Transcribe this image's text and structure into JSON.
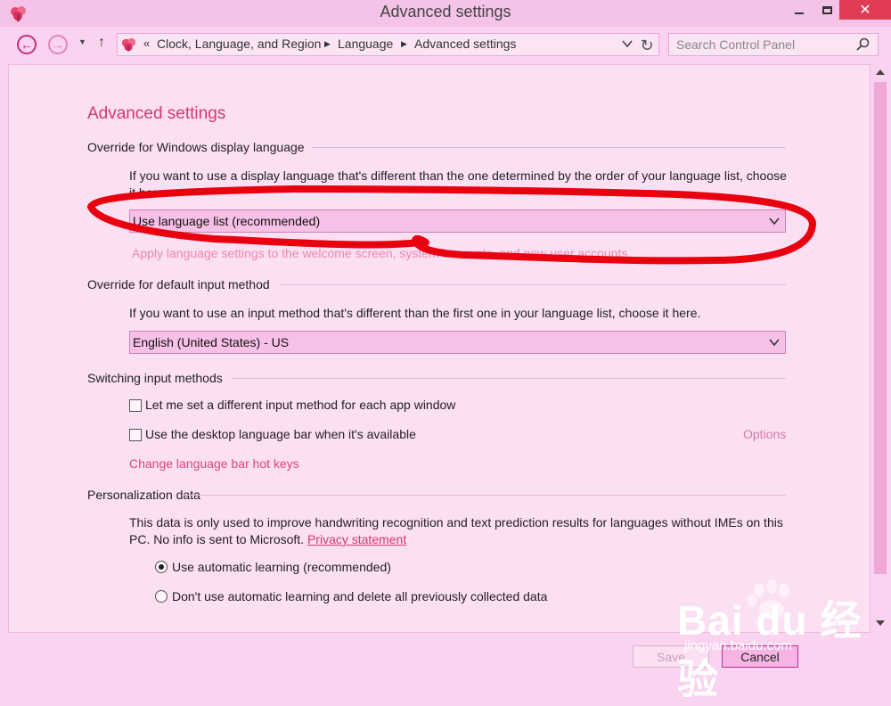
{
  "window": {
    "title": "Advanced settings"
  },
  "nav": {
    "breadcrumb_lead": "«",
    "breadcrumbs": [
      "Clock, Language, and Region",
      "Language",
      "Advanced settings"
    ]
  },
  "search": {
    "placeholder": "Search Control Panel",
    "value": ""
  },
  "page": {
    "heading": "Advanced settings",
    "display_language": {
      "title": "Override for Windows display language",
      "description": "If you want to use a display language that's different than the one determined by the order of your language list, choose it here.",
      "dropdown_value": "Use language list (recommended)",
      "apply_link": "Apply language settings to the welcome screen, system accounts, and new user accounts"
    },
    "input_method": {
      "title": "Override for default input method",
      "description": "If you want to use an input method that's different than the first one in your language list, choose it here.",
      "dropdown_value": "English (United States) - US"
    },
    "switching": {
      "title": "Switching input methods",
      "checkbox1_label": "Let me set a different input method for each app window",
      "checkbox2_label": "Use the desktop language bar when it's available",
      "options_link": "Options",
      "hotkeys_link": "Change language bar hot keys"
    },
    "personalization": {
      "title": "Personalization data",
      "description": "This data is only used to improve handwriting recognition and text prediction results for languages without IMEs on this PC. No info is sent to Microsoft.",
      "privacy_link": "Privacy statement",
      "radio1_label": "Use automatic learning (recommended)",
      "radio2_label": "Don't use automatic learning and delete all previously collected data"
    }
  },
  "footer": {
    "save_label": "Save",
    "cancel_label": "Cancel"
  },
  "watermark": {
    "text": "Bai du 经验",
    "url": "jingyan.baidu.com"
  },
  "colors": {
    "accent": "#d43a6d",
    "annotation": "#e8000f",
    "background": "#f9d3ef"
  }
}
